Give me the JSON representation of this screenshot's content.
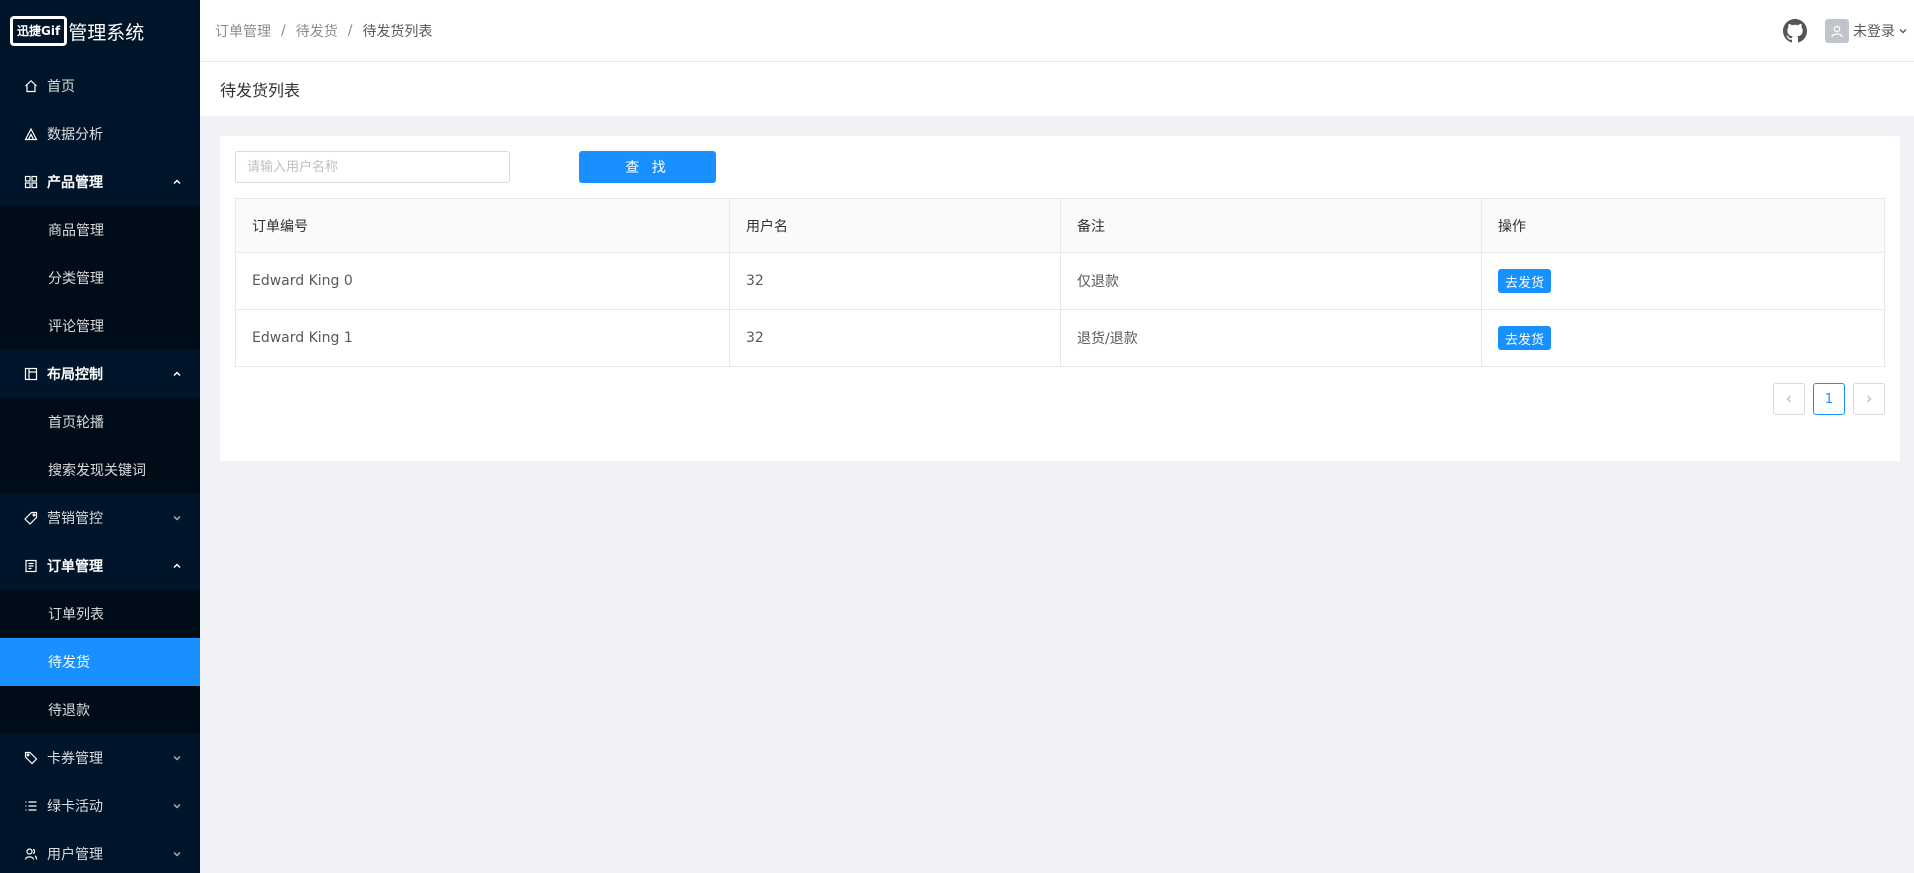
{
  "app": {
    "logo_text": "迅捷Gif",
    "title": "管理系统"
  },
  "sidebar": {
    "items": [
      {
        "label": "首页",
        "icon": "home-icon"
      },
      {
        "label": "数据分析",
        "icon": "chart-icon"
      },
      {
        "label": "产品管理",
        "icon": "appstore-icon",
        "expanded": true,
        "children": [
          "商品管理",
          "分类管理",
          "评论管理"
        ]
      },
      {
        "label": "布局控制",
        "icon": "layout-icon",
        "expanded": true,
        "children": [
          "首页轮播",
          "搜索发现关键词"
        ]
      },
      {
        "label": "营销管控",
        "icon": "tag-icon",
        "expanded": false
      },
      {
        "label": "订单管理",
        "icon": "order-icon",
        "expanded": true,
        "children": [
          "订单列表",
          "待发货",
          "待退款"
        ],
        "active_child": "待发货"
      },
      {
        "label": "卡券管理",
        "icon": "coupon-icon",
        "expanded": false
      },
      {
        "label": "绿卡活动",
        "icon": "list-icon",
        "expanded": false
      },
      {
        "label": "用户管理",
        "icon": "user-group-icon",
        "expanded": false
      }
    ]
  },
  "header": {
    "breadcrumb": [
      "订单管理",
      "待发货",
      "待发货列表"
    ],
    "user_label": "未登录"
  },
  "page": {
    "title": "待发货列表"
  },
  "search": {
    "placeholder": "请输入用户名称",
    "value": "",
    "button_label": "查 找"
  },
  "table": {
    "columns": [
      "订单编号",
      "用户名",
      "备注",
      "操作"
    ],
    "rows": [
      {
        "order_no": "Edward King 0",
        "username": "32",
        "remark": "仅退款",
        "action": "去发货"
      },
      {
        "order_no": "Edward King 1",
        "username": "32",
        "remark": "退货/退款",
        "action": "去发货"
      }
    ]
  },
  "pagination": {
    "current": "1"
  },
  "colors": {
    "sidebar_bg": "#001529",
    "submenu_bg": "#000c17",
    "primary": "#1890ff"
  }
}
